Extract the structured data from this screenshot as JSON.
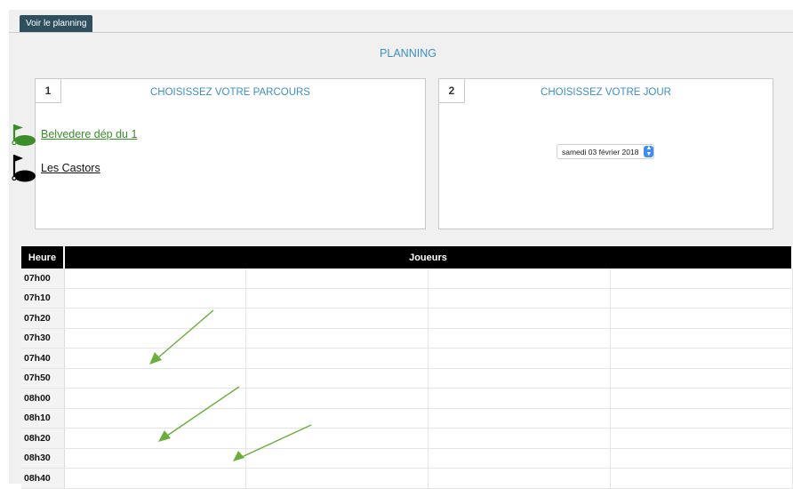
{
  "tab": {
    "label": "Voir le planning"
  },
  "page": {
    "title": "PLANNING"
  },
  "step1": {
    "number": "1",
    "title": "CHOISISSEZ VOTRE PARCOURS",
    "courses": [
      {
        "name": "Belvedere dép du 1",
        "flag_color": "#3b8d2a"
      },
      {
        "name": "Les Castors",
        "flag_color": "#000000"
      }
    ]
  },
  "step2": {
    "number": "2",
    "title": "CHOISISSEZ VOTRE JOUR",
    "date_value": "samedi 03 février 2018"
  },
  "table": {
    "headers": {
      "time": "Heure",
      "players": "Joueurs"
    },
    "times": [
      "07h00",
      "07h10",
      "07h20",
      "07h30",
      "07h40",
      "07h50",
      "08h00",
      "08h10",
      "08h20",
      "08h30",
      "08h40"
    ]
  },
  "colors": {
    "accent": "#3d8fc4",
    "tab_bg": "#2f4f5e",
    "arrow": "#6aae3c"
  }
}
